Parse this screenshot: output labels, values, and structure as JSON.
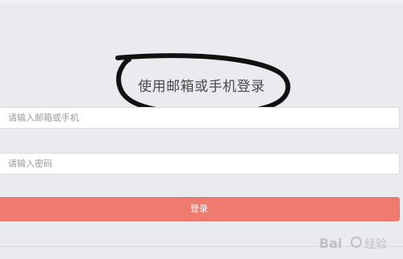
{
  "login": {
    "title": "使用邮箱或手机登录",
    "email_placeholder": "请输入邮箱或手机",
    "password_placeholder": "请输入密码",
    "submit_label": "登录"
  },
  "watermark": {
    "text": "Bai 经验"
  },
  "colors": {
    "background": "#e9ebef",
    "button": "#ef7b70",
    "button_text": "#ffffff",
    "annotation_stroke": "#111111"
  }
}
